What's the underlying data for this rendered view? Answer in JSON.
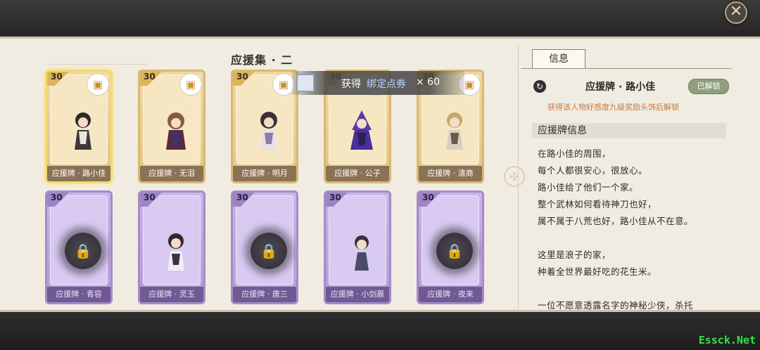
{
  "header": {
    "close_icon": "close-x-icon"
  },
  "collection_title": "应援集 · 二",
  "toast": {
    "prefix": "获得",
    "item": "绑定点券",
    "count": "× 60",
    "icon": "ticket-icon"
  },
  "cards": [
    {
      "level": "30",
      "label": "应援牌 · 路小佳",
      "state": "unlocked",
      "selected": true,
      "reward_icon": "treasure-chest-icon"
    },
    {
      "level": "30",
      "label": "应援牌 · 无泪",
      "state": "unlocked",
      "selected": false,
      "reward_icon": "treasure-chest-icon"
    },
    {
      "level": "30",
      "label": "应援牌 · 明月",
      "state": "unlocked",
      "selected": false,
      "reward_icon": "treasure-chest-icon"
    },
    {
      "level": "30",
      "label": "应援牌 · 公子",
      "state": "unlocked",
      "selected": false,
      "reward_icon": "treasure-chest-icon"
    },
    {
      "level": "30",
      "label": "应援牌 · 清商",
      "state": "unlocked",
      "selected": false,
      "reward_icon": "treasure-chest-icon"
    },
    {
      "level": "30",
      "label": "应援牌 · 青容",
      "state": "locked"
    },
    {
      "level": "30",
      "label": "应援牌 · 灵玉",
      "state": "locked-revealed"
    },
    {
      "level": "30",
      "label": "应援牌 · 唐三",
      "state": "locked"
    },
    {
      "level": "30",
      "label": "应援牌 · 小剑晨",
      "state": "locked-revealed"
    },
    {
      "level": "30",
      "label": "应援牌 · 夜来",
      "state": "locked"
    }
  ],
  "info_panel": {
    "tab": "信息",
    "name": "应援牌 · 路小佳",
    "badge": "已解锁",
    "unlock_note": "获得该人物好感度九级奖励头饰后解锁",
    "section_title": "应援牌信息",
    "lines": [
      "在路小佳的周围，",
      "每个人都很安心，很放心。",
      "路小佳给了他们一个家。",
      "整个武林如何看待神刀也好，",
      "属不属于八荒也好，路小佳从不在意。",
      "",
      "这里是浪子的家，",
      "种着全世界最好吃的花生米。",
      "",
      "一位不愿意透露名字的神秘少侠，杀托"
    ]
  },
  "watermark": "Essck.Net",
  "colors": {
    "gold_card": "#e2c383",
    "locked_card": "#b39ad6",
    "badge": "#8e9f7c",
    "note": "#c47a3d"
  }
}
